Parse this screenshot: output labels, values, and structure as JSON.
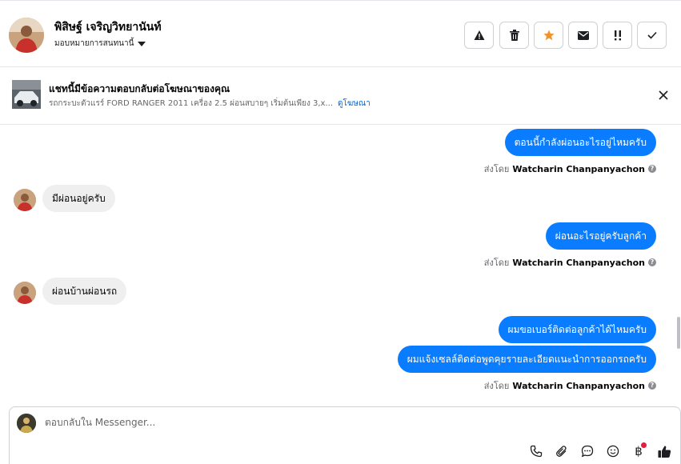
{
  "header": {
    "name": "พิสิษฐ์ เจริญวิทยานันท์",
    "assign_label": "มอบหมายการสนทนานี้",
    "actions": [
      {
        "icon": "warning-icon"
      },
      {
        "icon": "trash-icon"
      },
      {
        "icon": "star-icon",
        "color": "#f0932b"
      },
      {
        "icon": "envelope-icon"
      },
      {
        "icon": "exclamation-icon"
      },
      {
        "icon": "check-icon"
      }
    ]
  },
  "ad": {
    "title": "แชทนี้มีข้อความตอบกลับต่อโฆษณาของคุณ",
    "subtitle": "รถกระบะตัวแรร์ FORD RANGER 2011 เครื่อง 2.5 ผ่อนสบายๆ เริ่มต้นเพียง 3,x...",
    "link": "ดูโฆษณา"
  },
  "messages": [
    {
      "from": "page",
      "text": "ตอนนี้กำลังผ่อนอะไรอยู่ไหมครับ"
    },
    {
      "from": "page_meta",
      "prefix": "ส่งโดย",
      "sender": "Watcharin Chanpanyachon"
    },
    {
      "from": "user",
      "text": "มีผ่อนอยู่ครับ"
    },
    {
      "from": "page",
      "text": "ผ่อนอะไรอยู่ครับลูกค้า"
    },
    {
      "from": "page_meta",
      "prefix": "ส่งโดย",
      "sender": "Watcharin Chanpanyachon"
    },
    {
      "from": "user",
      "text": "ผ่อนบ้านผ่อนรถ"
    },
    {
      "from": "page",
      "text": "ผมขอเบอร์ติดต่อลูกค้าได้ไหมครับ"
    },
    {
      "from": "page",
      "text": "ผมแจ้งเซลล์ติดต่อพูดคุยรายละเอียดแนะนำการออกรถครับ"
    },
    {
      "from": "page_meta",
      "prefix": "ส่งโดย",
      "sender": "Watcharin Chanpanyachon"
    }
  ],
  "composer": {
    "placeholder": "ตอบกลับใน Messenger...",
    "tools": [
      "phone-icon",
      "paperclip-icon",
      "chat-bubble-icon",
      "smiley-icon",
      "baht-icon",
      "thumbs-up-icon"
    ],
    "baht_symbol": "฿"
  },
  "colors": {
    "outgoing_bubble": "#0a7cff",
    "incoming_bubble": "#efefef",
    "link": "#0064d1",
    "notification_dot": "#e41e3f"
  }
}
